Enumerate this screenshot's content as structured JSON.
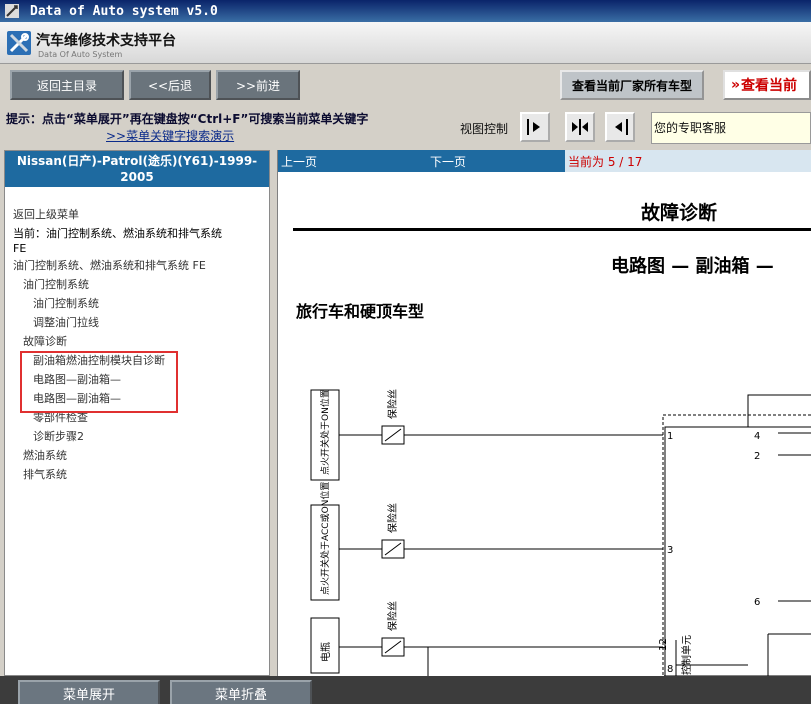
{
  "window": {
    "title": "Data of Auto system v5.0"
  },
  "brand": {
    "title": "汽车维修技术支持平台",
    "subtitle": "Data Of Auto System"
  },
  "toolbar": {
    "back_main": "返回主目录",
    "back": "<<后退",
    "forward": ">>前进",
    "all_models": "查看当前厂家所有车型",
    "view_current": "查看当前"
  },
  "hint": {
    "text": "提示：点击“菜单展开”再在键盘按“Ctrl+F”可搜索当前菜单关键字",
    "demo_link": ">>菜单关键字搜索演示",
    "view_control_label": "视图控制",
    "service_label": "您的专职客服"
  },
  "sidebar": {
    "car_title_line1": "Nissan(日产)-Patrol(途乐)(Y61)-1999-",
    "car_title_line2": "2005",
    "back_to_parent": "返回上级菜单",
    "current_prefix": "当前：油门控制系统、燃油系统和排气系统",
    "current_suffix": "FE",
    "items": [
      {
        "label": "油门控制系统、燃油系统和排气系统 FE",
        "level": 0
      },
      {
        "label": "油门控制系统",
        "level": 1
      },
      {
        "label": "油门控制系统",
        "level": 2
      },
      {
        "label": "调整油门拉线",
        "level": 2
      },
      {
        "label": "故障诊断",
        "level": 1
      },
      {
        "label": "副油箱燃油控制模块自诊断",
        "level": 2
      },
      {
        "label": "电路图—副油箱—",
        "level": 2
      },
      {
        "label": "电路图—副油箱—",
        "level": 2
      },
      {
        "label": "零部件检查",
        "level": 2
      },
      {
        "label": "诊断步骤2",
        "level": 2
      },
      {
        "label": "燃油系统",
        "level": 1
      },
      {
        "label": "排气系统",
        "level": 1
      }
    ]
  },
  "nav": {
    "prev": "上一页",
    "next": "下一页",
    "page_info": "当前为  5 / 17"
  },
  "document": {
    "title": "故障诊断",
    "subtitle": "电路图 — 副油箱 —",
    "section": "旅行车和硬顶车型",
    "boxes": [
      "点火开关处于ON位置",
      "点火开关处于ACC或ON位置",
      "电瓶"
    ],
    "fuse_label": "保险丝",
    "pins_left": [
      "1",
      "3",
      "8",
      "12"
    ],
    "pins_right": [
      "4",
      "2",
      "6"
    ],
    "unit_text": "控制单元"
  },
  "bottom": {
    "expand": "菜单展开",
    "collapse": "菜单折叠"
  }
}
